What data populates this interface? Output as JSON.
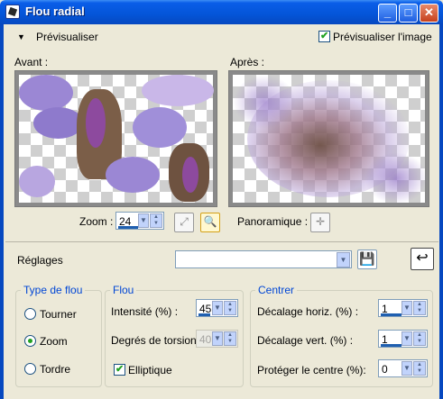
{
  "window": {
    "title": "Flou radial"
  },
  "window_controls": {
    "minimize": "_",
    "maximize": "□",
    "close": "✕"
  },
  "preview": {
    "toggle_label": "Prévisualiser",
    "preview_checkbox_label": "Prévisualiser l'image",
    "preview_checked": true,
    "before_label": "Avant :",
    "after_label": "Après :",
    "zoom_label": "Zoom :",
    "zoom_value": "24",
    "pan_label": "Panoramique :"
  },
  "settings": {
    "label": "Réglages",
    "preset_value": ""
  },
  "blur_type": {
    "title": "Type de flou",
    "options": [
      "Tourner",
      "Zoom",
      "Tordre"
    ],
    "selected": "Zoom"
  },
  "blur": {
    "title": "Flou",
    "intensity_label": "Intensité (%) :",
    "intensity_value": "45",
    "twist_label": "Degrés de torsion :",
    "twist_value": "40",
    "elliptical_label": "Elliptique",
    "elliptical_checked": true
  },
  "center": {
    "title": "Centrer",
    "h_offset_label": "Décalage horiz. (%) :",
    "h_offset_value": "1",
    "v_offset_label": "Décalage vert. (%) :",
    "v_offset_value": "1",
    "protect_label": "Protéger le centre (%):",
    "protect_value": "0"
  },
  "colors": {
    "title_bar": "#0455D8",
    "dialog_bg": "#ECE9D8",
    "group_title": "#0046D5",
    "check_green": "#21A121"
  }
}
